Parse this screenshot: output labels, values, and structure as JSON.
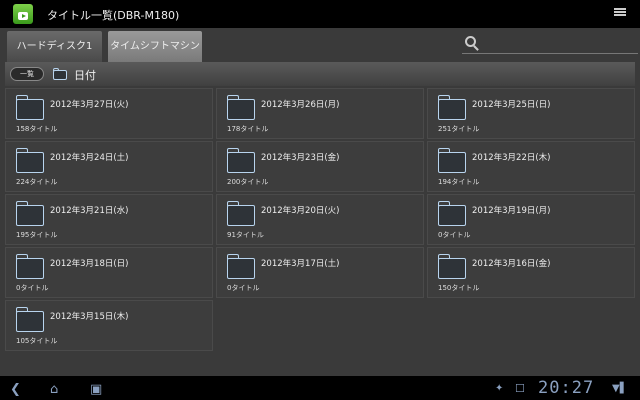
{
  "app": {
    "title": "タイトル一覧(DBR-M180)"
  },
  "tabs": [
    {
      "label": "ハードディスク1"
    },
    {
      "label": "タイムシフトマシン"
    }
  ],
  "search": {
    "placeholder": ""
  },
  "breadcrumb": {
    "list_button": "一覧",
    "current": "日付"
  },
  "folders": [
    {
      "date": "2012年3月27日(火)",
      "count": "158タイトル"
    },
    {
      "date": "2012年3月26日(月)",
      "count": "178タイトル"
    },
    {
      "date": "2012年3月25日(日)",
      "count": "251タイトル"
    },
    {
      "date": "2012年3月24日(土)",
      "count": "224タイトル"
    },
    {
      "date": "2012年3月23日(金)",
      "count": "200タイトル"
    },
    {
      "date": "2012年3月22日(木)",
      "count": "194タイトル"
    },
    {
      "date": "2012年3月21日(水)",
      "count": "195タイトル"
    },
    {
      "date": "2012年3月20日(火)",
      "count": "91タイトル"
    },
    {
      "date": "2012年3月19日(月)",
      "count": "0タイトル"
    },
    {
      "date": "2012年3月18日(日)",
      "count": "0タイトル"
    },
    {
      "date": "2012年3月17日(土)",
      "count": "0タイトル"
    },
    {
      "date": "2012年3月16日(金)",
      "count": "150タイトル"
    },
    {
      "date": "2012年3月15日(木)",
      "count": "105タイトル"
    }
  ],
  "status": {
    "time": "20:27"
  }
}
